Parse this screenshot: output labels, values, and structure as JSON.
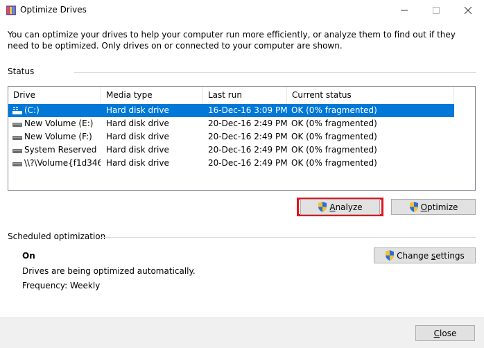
{
  "window": {
    "title": "Optimize Drives",
    "icon": "defrag-app-icon"
  },
  "intro_text": "You can optimize your drives to help your computer run more efficiently, or analyze them to find out if they need to be optimized. Only drives on or connected to your computer are shown.",
  "status_section": {
    "label": "Status",
    "columns": [
      "Drive",
      "Media type",
      "Last run",
      "Current status"
    ],
    "rows": [
      {
        "drive": "(C:)",
        "media": "Hard disk drive",
        "last_run": "16-Dec-16 3:09 PM",
        "status": "OK (0% fragmented)",
        "selected": true,
        "icon": "windows-drive-icon"
      },
      {
        "drive": "New Volume (E:)",
        "media": "Hard disk drive",
        "last_run": "20-Dec-16 2:49 PM",
        "status": "OK (0% fragmented)",
        "selected": false,
        "icon": "hard-drive-icon"
      },
      {
        "drive": "New Volume (F:)",
        "media": "Hard disk drive",
        "last_run": "20-Dec-16 2:49 PM",
        "status": "OK (0% fragmented)",
        "selected": false,
        "icon": "hard-drive-icon"
      },
      {
        "drive": "System Reserved",
        "media": "Hard disk drive",
        "last_run": "20-Dec-16 2:49 PM",
        "status": "OK (0% fragmented)",
        "selected": false,
        "icon": "hard-drive-icon"
      },
      {
        "drive": "\\\\?\\Volume{f1d346...",
        "media": "Hard disk drive",
        "last_run": "20-Dec-16 2:49 PM",
        "status": "OK (0% fragmented)",
        "selected": false,
        "icon": "hard-drive-icon"
      }
    ]
  },
  "buttons": {
    "analyze_pre": "",
    "analyze_u": "A",
    "analyze_post": "nalyze",
    "optimize_pre": "",
    "optimize_u": "O",
    "optimize_post": "ptimize",
    "change_pre": "Change ",
    "change_u": "s",
    "change_post": "ettings",
    "close_pre": "",
    "close_u": "C",
    "close_post": "lose"
  },
  "scheduled": {
    "label": "Scheduled optimization",
    "state": "On",
    "description": "Drives are being optimized automatically.",
    "frequency": "Frequency: Weekly"
  },
  "colors": {
    "selection": "#0078d7",
    "highlight_box": "#e0141e",
    "button_face": "#e1e1e1"
  }
}
